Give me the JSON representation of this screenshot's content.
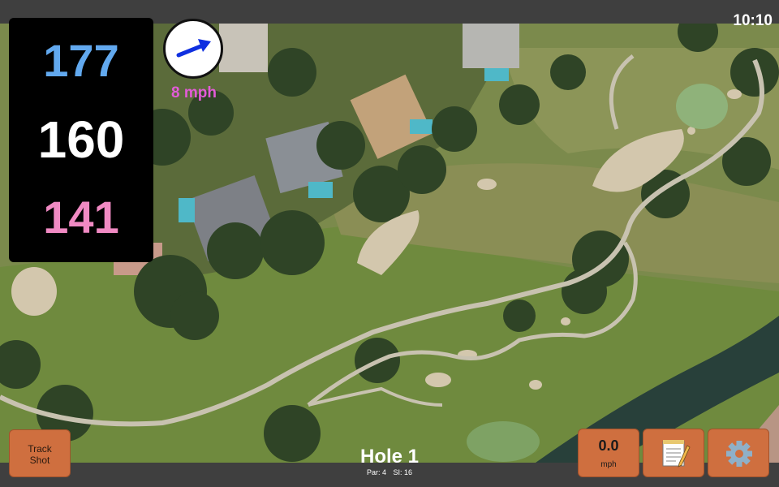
{
  "status_bar": {
    "time": "10:10"
  },
  "distances": {
    "back": "177",
    "middle": "160",
    "front": "141"
  },
  "wind": {
    "speed": "8 mph",
    "icon": "wind-direction-arrow-icon"
  },
  "hole": {
    "title": "Hole 1",
    "par": "Par: 4",
    "stroke_index": "SI: 16"
  },
  "buttons": {
    "track_shot_line1": "Track",
    "track_shot_line2": "Shot",
    "speed_value": "0.0",
    "speed_unit": "mph",
    "notes_icon": "notepad-icon",
    "settings_icon": "gear-icon"
  },
  "colors": {
    "back_distance": "#62a9ef",
    "middle_distance": "#ffffff",
    "front_distance": "#f08ac3",
    "wind_text": "#e35bd8",
    "button_bg": "#cf6f3f",
    "arrow": "#1030e0"
  }
}
